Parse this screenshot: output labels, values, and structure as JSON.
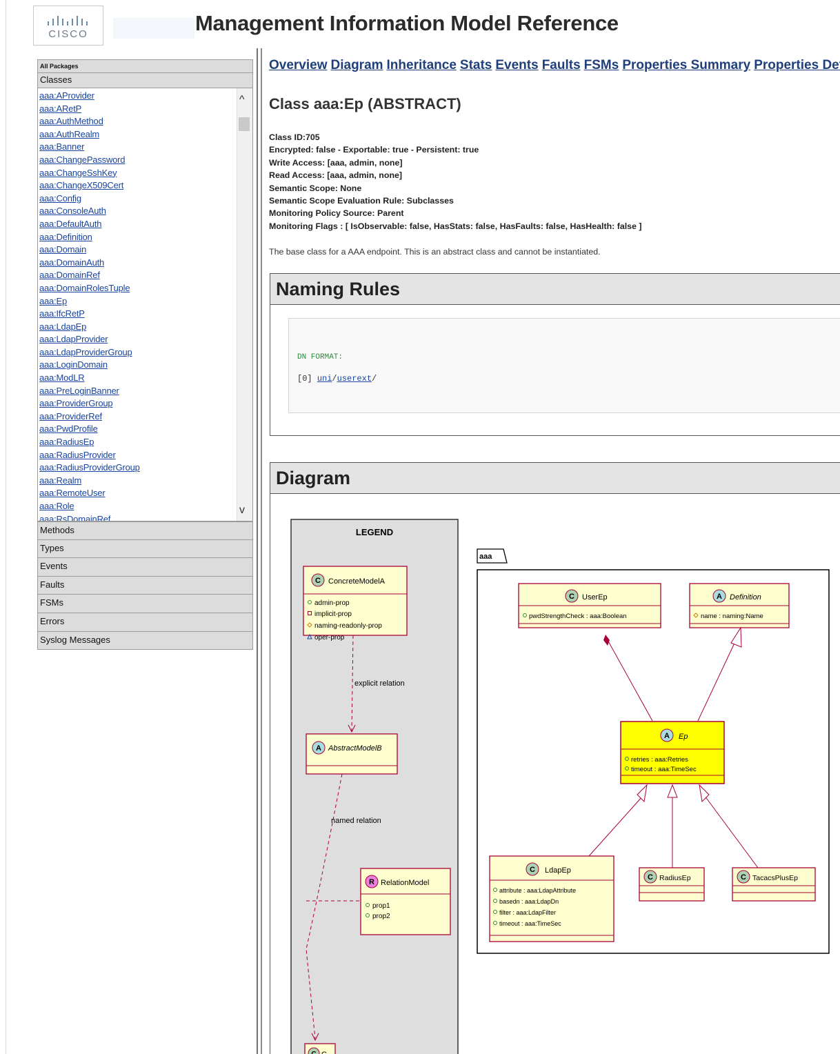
{
  "header": {
    "logo_text": "CISCO",
    "title": "Management Information Model Reference"
  },
  "sidebar": {
    "all_packages": "All Packages",
    "classes_label": "Classes",
    "classes": [
      "aaa:AProvider",
      "aaa:ARetP",
      "aaa:AuthMethod",
      "aaa:AuthRealm",
      "aaa:Banner",
      "aaa:ChangePassword",
      "aaa:ChangeSshKey",
      "aaa:ChangeX509Cert",
      "aaa:Config",
      "aaa:ConsoleAuth",
      "aaa:DefaultAuth",
      "aaa:Definition",
      "aaa:Domain",
      "aaa:DomainAuth",
      "aaa:DomainRef",
      "aaa:DomainRolesTuple",
      "aaa:Ep",
      "aaa:IfcRetP",
      "aaa:LdapEp",
      "aaa:LdapProvider",
      "aaa:LdapProviderGroup",
      "aaa:LoginDomain",
      "aaa:ModLR",
      "aaa:PreLoginBanner",
      "aaa:ProviderGroup",
      "aaa:ProviderRef",
      "aaa:PwdProfile",
      "aaa:RadiusEp",
      "aaa:RadiusProvider",
      "aaa:RadiusProviderGroup",
      "aaa:Realm",
      "aaa:RemoteUser",
      "aaa:Role",
      "aaa:RsDomainRef"
    ],
    "sections": [
      "Methods",
      "Types",
      "Events",
      "Faults",
      "FSMs",
      "Errors",
      "Syslog Messages"
    ],
    "scroll_up_glyph": "^",
    "scroll_down_glyph": "v"
  },
  "main": {
    "tabs": [
      "Overview",
      "Diagram",
      "Inheritance",
      "Stats",
      "Events",
      "Faults",
      "FSMs",
      "Properties Summary",
      "Properties Detail"
    ],
    "class_heading": "Class aaa:Ep (ABSTRACT)",
    "properties": [
      "Class ID:705",
      "Encrypted: false - Exportable: true - Persistent: true",
      "Write Access: [aaa, admin, none]",
      "Read Access: [aaa, admin, none]",
      "Semantic Scope: None",
      "Semantic Scope Evaluation Rule: Subclasses",
      "Monitoring Policy Source: Parent",
      "Monitoring Flags : [ IsObservable: false, HasStats: false, HasFaults: false, HasHealth: false ]"
    ],
    "description": "The base class for a AAA endpoint. This is an abstract class and cannot be instantiated.",
    "naming_rules": {
      "title": "Naming Rules",
      "dn_format": "DN FORMAT:",
      "dn_index": "[0]",
      "dn_part1": "uni",
      "dn_sep1": "/",
      "dn_part2": "userext",
      "dn_sep2": "/"
    },
    "diagram": {
      "title": "Diagram",
      "legend": {
        "title": "LEGEND",
        "concrete": {
          "badge": "C",
          "name": "ConcreteModelA",
          "props": [
            "admin-prop",
            "implicit-prop",
            "naming-readonly-prop",
            "oper-prop"
          ]
        },
        "explicit_relation": "explicit relation",
        "abstract": {
          "badge": "A",
          "name": "AbstractModelB"
        },
        "named_relation": "named relation",
        "relation": {
          "badge": "R",
          "name": "RelationModel",
          "props": [
            "prop1",
            "prop2"
          ]
        },
        "c_class": {
          "badge": "C",
          "name": "C"
        }
      },
      "package": {
        "name": "aaa",
        "userep": {
          "badge": "C",
          "name": "UserEp",
          "props": [
            "pwdStrengthCheck : aaa:Boolean"
          ]
        },
        "definition": {
          "badge": "A",
          "name": "Definition",
          "props": [
            "name : naming:Name"
          ]
        },
        "ep": {
          "badge": "A",
          "name": "Ep",
          "props": [
            "retries : aaa:Retries",
            "timeout : aaa:TimeSec"
          ]
        },
        "ldapep": {
          "badge": "C",
          "name": "LdapEp",
          "props": [
            "attribute : aaa:LdapAttribute",
            "basedn : aaa:LdapDn",
            "filter : aaa:LdapFilter",
            "timeout : aaa:TimeSec"
          ]
        },
        "radiusep": {
          "badge": "C",
          "name": "RadiusEp"
        },
        "tacacsplusep": {
          "badge": "C",
          "name": "TacacsPlusEp"
        }
      }
    }
  },
  "colors": {
    "link": "#1a45a0",
    "class_fill": "#fefece",
    "class_border": "#a80036",
    "highlight_fill": "#ffff00",
    "badge_class": "#add1b2",
    "badge_abstract": "#a9dcdf",
    "badge_relation": "#ea7fde"
  }
}
